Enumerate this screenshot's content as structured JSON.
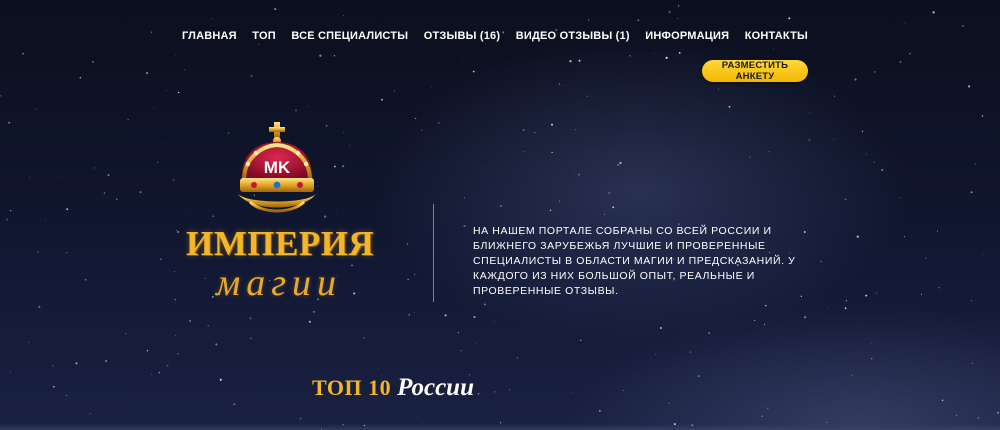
{
  "nav": {
    "items": [
      {
        "label": "ГЛАВНАЯ"
      },
      {
        "label": "ТОП"
      },
      {
        "label": "ВСЕ СПЕЦИАЛИСТЫ"
      },
      {
        "label": "ОТЗЫВЫ (16)"
      },
      {
        "label": "ВИДЕО ОТЗЫВЫ (1)"
      },
      {
        "label": "ИНФОРМАЦИЯ"
      },
      {
        "label": "КОНТАКТЫ"
      }
    ]
  },
  "cta": {
    "label": "РАЗМЕСТИТЬ АНКЕТУ",
    "color": "#ffc81a"
  },
  "logo": {
    "monogram": "MK",
    "title": "ИМПЕРИЯ",
    "subtitle": "магии",
    "gold_color": "#f3b62a",
    "velvet_color": "#b01535"
  },
  "intro": {
    "text": "На нашем портале собраны со всей России и ближнего зарубежья лучшие и проверенные специалисты в области магии и предсказаний. У каждого из них большой опыт, реальные и проверенные отзывы."
  },
  "section": {
    "title_bold": "ТОП 10",
    "title_italic": "России"
  }
}
